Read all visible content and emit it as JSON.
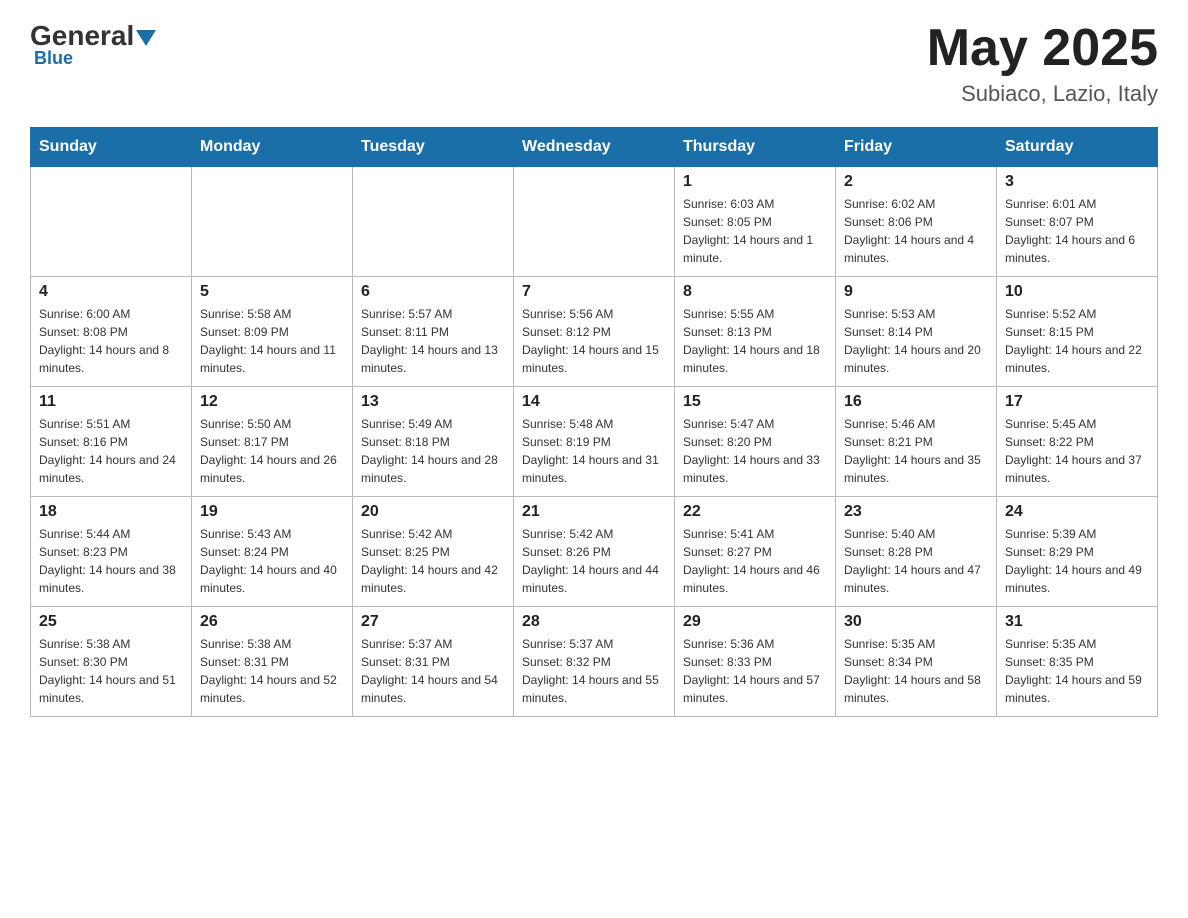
{
  "header": {
    "logo_general": "General",
    "logo_blue": "Blue",
    "title": "May 2025",
    "subtitle": "Subiaco, Lazio, Italy"
  },
  "days_of_week": [
    "Sunday",
    "Monday",
    "Tuesday",
    "Wednesday",
    "Thursday",
    "Friday",
    "Saturday"
  ],
  "weeks": [
    [
      {
        "day": "",
        "info": ""
      },
      {
        "day": "",
        "info": ""
      },
      {
        "day": "",
        "info": ""
      },
      {
        "day": "",
        "info": ""
      },
      {
        "day": "1",
        "info": "Sunrise: 6:03 AM\nSunset: 8:05 PM\nDaylight: 14 hours and 1 minute."
      },
      {
        "day": "2",
        "info": "Sunrise: 6:02 AM\nSunset: 8:06 PM\nDaylight: 14 hours and 4 minutes."
      },
      {
        "day": "3",
        "info": "Sunrise: 6:01 AM\nSunset: 8:07 PM\nDaylight: 14 hours and 6 minutes."
      }
    ],
    [
      {
        "day": "4",
        "info": "Sunrise: 6:00 AM\nSunset: 8:08 PM\nDaylight: 14 hours and 8 minutes."
      },
      {
        "day": "5",
        "info": "Sunrise: 5:58 AM\nSunset: 8:09 PM\nDaylight: 14 hours and 11 minutes."
      },
      {
        "day": "6",
        "info": "Sunrise: 5:57 AM\nSunset: 8:11 PM\nDaylight: 14 hours and 13 minutes."
      },
      {
        "day": "7",
        "info": "Sunrise: 5:56 AM\nSunset: 8:12 PM\nDaylight: 14 hours and 15 minutes."
      },
      {
        "day": "8",
        "info": "Sunrise: 5:55 AM\nSunset: 8:13 PM\nDaylight: 14 hours and 18 minutes."
      },
      {
        "day": "9",
        "info": "Sunrise: 5:53 AM\nSunset: 8:14 PM\nDaylight: 14 hours and 20 minutes."
      },
      {
        "day": "10",
        "info": "Sunrise: 5:52 AM\nSunset: 8:15 PM\nDaylight: 14 hours and 22 minutes."
      }
    ],
    [
      {
        "day": "11",
        "info": "Sunrise: 5:51 AM\nSunset: 8:16 PM\nDaylight: 14 hours and 24 minutes."
      },
      {
        "day": "12",
        "info": "Sunrise: 5:50 AM\nSunset: 8:17 PM\nDaylight: 14 hours and 26 minutes."
      },
      {
        "day": "13",
        "info": "Sunrise: 5:49 AM\nSunset: 8:18 PM\nDaylight: 14 hours and 28 minutes."
      },
      {
        "day": "14",
        "info": "Sunrise: 5:48 AM\nSunset: 8:19 PM\nDaylight: 14 hours and 31 minutes."
      },
      {
        "day": "15",
        "info": "Sunrise: 5:47 AM\nSunset: 8:20 PM\nDaylight: 14 hours and 33 minutes."
      },
      {
        "day": "16",
        "info": "Sunrise: 5:46 AM\nSunset: 8:21 PM\nDaylight: 14 hours and 35 minutes."
      },
      {
        "day": "17",
        "info": "Sunrise: 5:45 AM\nSunset: 8:22 PM\nDaylight: 14 hours and 37 minutes."
      }
    ],
    [
      {
        "day": "18",
        "info": "Sunrise: 5:44 AM\nSunset: 8:23 PM\nDaylight: 14 hours and 38 minutes."
      },
      {
        "day": "19",
        "info": "Sunrise: 5:43 AM\nSunset: 8:24 PM\nDaylight: 14 hours and 40 minutes."
      },
      {
        "day": "20",
        "info": "Sunrise: 5:42 AM\nSunset: 8:25 PM\nDaylight: 14 hours and 42 minutes."
      },
      {
        "day": "21",
        "info": "Sunrise: 5:42 AM\nSunset: 8:26 PM\nDaylight: 14 hours and 44 minutes."
      },
      {
        "day": "22",
        "info": "Sunrise: 5:41 AM\nSunset: 8:27 PM\nDaylight: 14 hours and 46 minutes."
      },
      {
        "day": "23",
        "info": "Sunrise: 5:40 AM\nSunset: 8:28 PM\nDaylight: 14 hours and 47 minutes."
      },
      {
        "day": "24",
        "info": "Sunrise: 5:39 AM\nSunset: 8:29 PM\nDaylight: 14 hours and 49 minutes."
      }
    ],
    [
      {
        "day": "25",
        "info": "Sunrise: 5:38 AM\nSunset: 8:30 PM\nDaylight: 14 hours and 51 minutes."
      },
      {
        "day": "26",
        "info": "Sunrise: 5:38 AM\nSunset: 8:31 PM\nDaylight: 14 hours and 52 minutes."
      },
      {
        "day": "27",
        "info": "Sunrise: 5:37 AM\nSunset: 8:31 PM\nDaylight: 14 hours and 54 minutes."
      },
      {
        "day": "28",
        "info": "Sunrise: 5:37 AM\nSunset: 8:32 PM\nDaylight: 14 hours and 55 minutes."
      },
      {
        "day": "29",
        "info": "Sunrise: 5:36 AM\nSunset: 8:33 PM\nDaylight: 14 hours and 57 minutes."
      },
      {
        "day": "30",
        "info": "Sunrise: 5:35 AM\nSunset: 8:34 PM\nDaylight: 14 hours and 58 minutes."
      },
      {
        "day": "31",
        "info": "Sunrise: 5:35 AM\nSunset: 8:35 PM\nDaylight: 14 hours and 59 minutes."
      }
    ]
  ]
}
